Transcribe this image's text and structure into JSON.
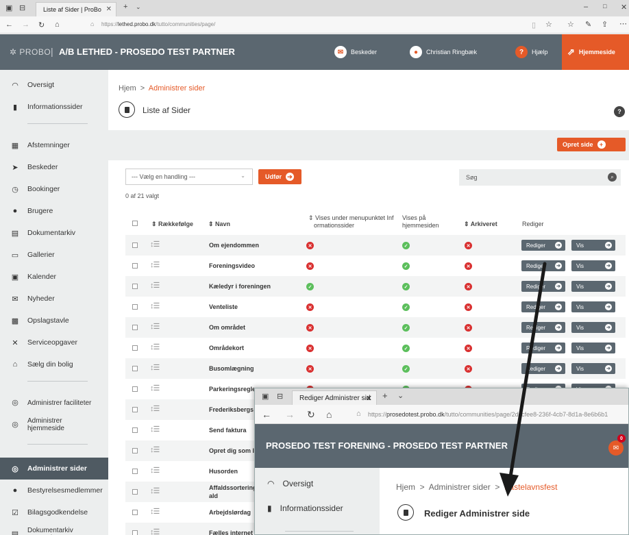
{
  "browser": {
    "tab_title": "Liste af Sider | ProBo",
    "url_prefix": "https://",
    "url_host": "lethed.probo.dk",
    "url_path": "/tutto/communities/page/"
  },
  "header": {
    "logo": "PROBO",
    "title": "A/B LETHED - PROSEDO TEST PARTNER",
    "beskeder": "Beskeder",
    "user": "Christian Ringbæk",
    "help": "Hjælp",
    "hjemmeside": "Hjemmeside"
  },
  "sidebar": {
    "items": [
      {
        "label": "Oversigt",
        "icon": "dashboard-icon",
        "glyph": "◠"
      },
      {
        "label": "Informationssider",
        "icon": "document-icon",
        "glyph": "▮"
      },
      {
        "label": "Afstemninger",
        "icon": "ballot-icon",
        "glyph": "▦"
      },
      {
        "label": "Beskeder",
        "icon": "send-icon",
        "glyph": "➤"
      },
      {
        "label": "Bookinger",
        "icon": "clock-icon",
        "glyph": "◷"
      },
      {
        "label": "Brugere",
        "icon": "user-icon",
        "glyph": "●"
      },
      {
        "label": "Dokumentarkiv",
        "icon": "archive-icon",
        "glyph": "▤"
      },
      {
        "label": "Gallerier",
        "icon": "gallery-icon",
        "glyph": "▭"
      },
      {
        "label": "Kalender",
        "icon": "calendar-icon",
        "glyph": "▣"
      },
      {
        "label": "Nyheder",
        "icon": "mail-icon",
        "glyph": "✉"
      },
      {
        "label": "Opslagstavle",
        "icon": "board-icon",
        "glyph": "▩"
      },
      {
        "label": "Serviceopgaver",
        "icon": "tools-icon",
        "glyph": "✕"
      },
      {
        "label": "Sælg din bolig",
        "icon": "house-icon",
        "glyph": "⌂"
      },
      {
        "label": "Administrer faciliteter",
        "icon": "settings-icon",
        "glyph": "◎"
      },
      {
        "label": "Administrer hjemmeside",
        "icon": "settings-icon",
        "glyph": "◎"
      },
      {
        "label": "Administrer sider",
        "icon": "settings-icon",
        "glyph": "◎"
      },
      {
        "label": "Bestyrelsesmedlemmer",
        "icon": "user-icon",
        "glyph": "●"
      },
      {
        "label": "Bilagsgodkendelse",
        "icon": "check-icon",
        "glyph": "☑"
      },
      {
        "label": "Dokumentarkiv Bestyrelse",
        "icon": "archive-icon",
        "glyph": "▤"
      }
    ]
  },
  "main": {
    "breadcrumb_home": "Hjem",
    "breadcrumb_sep": ">",
    "breadcrumb_current": "Administrer sider",
    "page_title": "Liste af Sider",
    "help_label": "?",
    "opret_label": "Opret side",
    "select_placeholder": "--- Vælg en handling ---",
    "udfor_label": "Udfør",
    "count_text": "0 af 21 valgt",
    "search_placeholder": "Søg",
    "headers": {
      "order": "Rækkefølge",
      "name": "Navn",
      "menu": "Vises under menupunktet Informationssider",
      "menu_line1": "Vises under menupunktet Inf",
      "menu_line2": "ormationssider",
      "home_line1": "Vises på",
      "home_line2": "hjemmesiden",
      "archived": "Arkiveret",
      "edit": "Rediger"
    },
    "row_buttons": {
      "edit": "Rediger",
      "view": "Vis"
    },
    "rows": [
      {
        "name": "Om ejendommen",
        "menu": false,
        "home": true,
        "archived": false
      },
      {
        "name": "Foreningsvideo",
        "menu": false,
        "home": true,
        "archived": false
      },
      {
        "name": "Kæledyr i foreningen",
        "menu": true,
        "home": true,
        "archived": false
      },
      {
        "name": "Venteliste",
        "menu": false,
        "home": true,
        "archived": false
      },
      {
        "name": "Om området",
        "menu": false,
        "home": true,
        "archived": false
      },
      {
        "name": "Områdekort",
        "menu": false,
        "home": true,
        "archived": false
      },
      {
        "name": "Busomlægning",
        "menu": false,
        "home": true,
        "archived": false
      },
      {
        "name": "Parkeringsregler",
        "menu": false,
        "home": true,
        "archived": false
      },
      {
        "name": "Frederiksbergs",
        "menu": null,
        "home": null,
        "archived": null
      },
      {
        "name": "Send faktura",
        "menu": null,
        "home": null,
        "archived": null
      },
      {
        "name": "Opret dig som l",
        "menu": null,
        "home": null,
        "archived": null
      },
      {
        "name": "Husorden",
        "menu": null,
        "home": null,
        "archived": null
      },
      {
        "name": "Affaldssortering",
        "name2": "ald",
        "menu": null,
        "home": null,
        "archived": null
      },
      {
        "name": "Arbejdslørdag",
        "menu": null,
        "home": null,
        "archived": null
      },
      {
        "name": "Fælles internet",
        "menu": null,
        "home": null,
        "archived": null
      }
    ]
  },
  "overlay": {
    "tab_title": "Rediger Administrer sid",
    "url_prefix": "https://",
    "url_host": "prosedotest.probo.dk",
    "url_path": "/tutto/communities/page/2dccfee8-236f-4cb7-8d1a-8e6b6b1",
    "header_title": "PROSEDO TEST FORENING - PROSEDO TEST PARTNER",
    "badge": "0",
    "sidebar": [
      "Oversigt",
      "Informationssider"
    ],
    "breadcrumb_home": "Hjem",
    "breadcrumb_mid": "Administrer sider",
    "breadcrumb_current": "Fastelavnsfest",
    "page_title": "Rediger Administrer side"
  },
  "colors": {
    "accent": "#e55a28",
    "header": "#5b6770",
    "sidebar": "#eceeee",
    "ok": "#5cbf5c",
    "no": "#d93030"
  }
}
